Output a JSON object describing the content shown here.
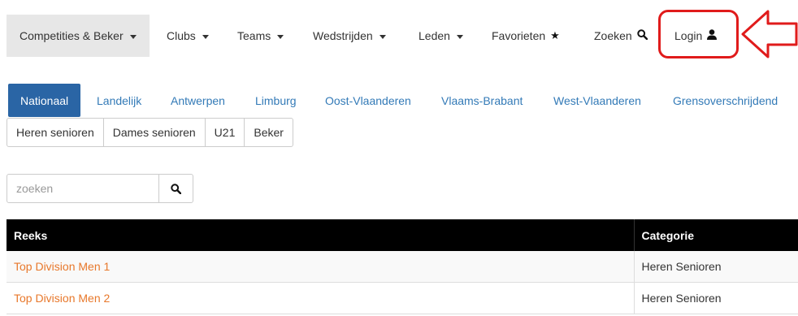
{
  "navbar": {
    "items": [
      {
        "label": "Competities & Beker",
        "has_caret": true
      },
      {
        "label": "Clubs",
        "has_caret": true
      },
      {
        "label": "Teams",
        "has_caret": true
      },
      {
        "label": "Wedstrijden",
        "has_caret": true
      },
      {
        "label": "Leden",
        "has_caret": true
      },
      {
        "label": "Favorieten",
        "icon": "star-icon"
      },
      {
        "label": "Zoeken",
        "icon": "search-icon"
      },
      {
        "label": "Login",
        "icon": "user-icon"
      }
    ],
    "active_index": 0,
    "highlight_color": "#e01b1b"
  },
  "regions": {
    "items": [
      "Nationaal",
      "Landelijk",
      "Antwerpen",
      "Limburg",
      "Oost-Vlaanderen",
      "Vlaams-Brabant",
      "West-Vlaanderen",
      "Grensoverschrijdend"
    ],
    "active_index": 0,
    "active_color": "#2a65a5",
    "link_color": "#337ab7"
  },
  "categories": {
    "items": [
      "Heren senioren",
      "Dames senioren",
      "U21",
      "Beker"
    ]
  },
  "search": {
    "placeholder": "zoeken",
    "value": ""
  },
  "table": {
    "headers": {
      "reeks": "Reeks",
      "categorie": "Categorie"
    },
    "rows": [
      {
        "reeks": "Top Division Men 1",
        "categorie": "Heren Senioren"
      },
      {
        "reeks": "Top Division Men 2",
        "categorie": "Heren Senioren"
      }
    ],
    "link_color": "#e8782b",
    "header_bg": "#000000"
  }
}
